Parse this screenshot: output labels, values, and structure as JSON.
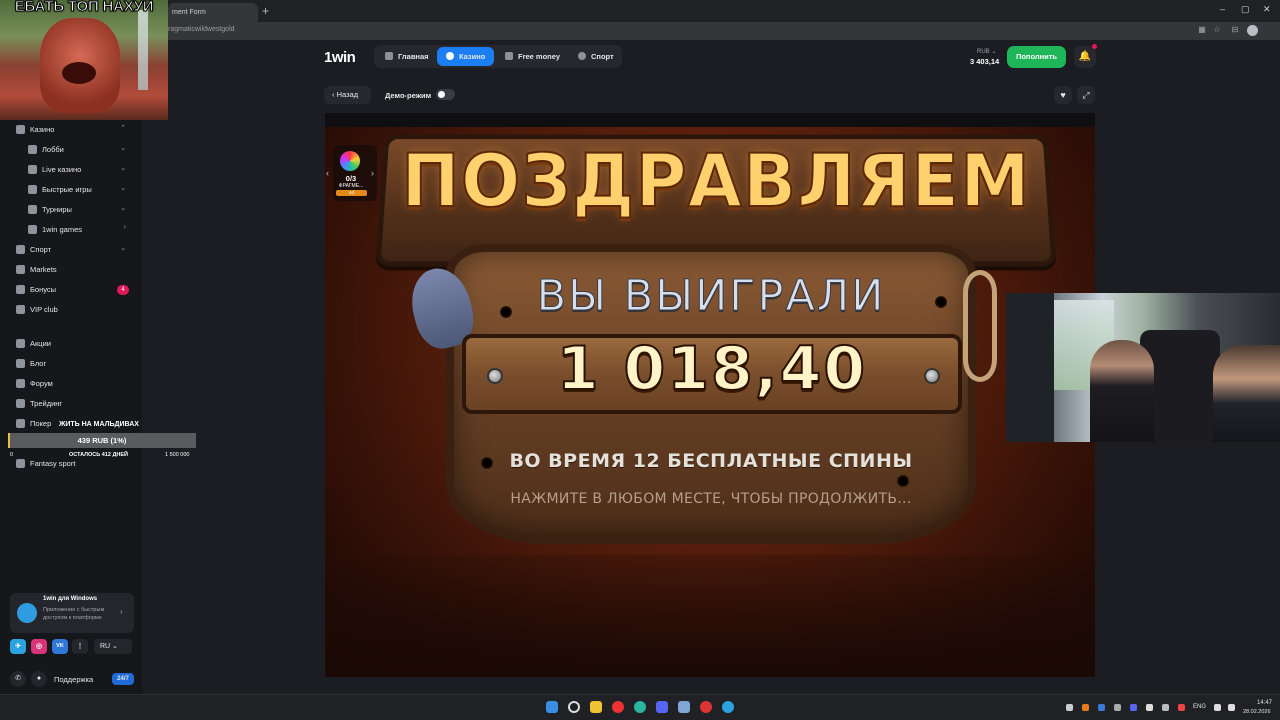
{
  "browser": {
    "tab_title": "ment Form",
    "url": "ragmaticwildwestgold",
    "new_tab": "+",
    "win_min": "–",
    "win_max": "▢",
    "win_close": "✕"
  },
  "overlay": {
    "meme_caption": "ЕБАТЬ ТОП НАХУЙ"
  },
  "header": {
    "logo": "1win",
    "nav": [
      {
        "label": "Главная",
        "icon": "home-icon"
      },
      {
        "label": "Казино",
        "icon": "casino-chip-icon"
      },
      {
        "label": "Free money",
        "icon": "wallet-icon"
      },
      {
        "label": "Спорт",
        "icon": "sport-ball-icon"
      }
    ],
    "currency": "RUB ⌄",
    "balance": "3 403,14",
    "deposit_label": "Пополнить",
    "bell_icon": "bell-icon"
  },
  "subheader": {
    "back_label": "‹   Назад",
    "demo_label": "Демо-режим",
    "demo_on": false
  },
  "sidebar": {
    "items": [
      {
        "label": "Казино",
        "chev": "⌃"
      },
      {
        "label": "Лобби",
        "chev": "⌄"
      },
      {
        "label": "Live казино",
        "chev": "⌄"
      },
      {
        "label": "Быстрые игры",
        "chev": "⌄"
      },
      {
        "label": "Турниры",
        "chev": "⌄"
      },
      {
        "label": "1win games",
        "chev": "›"
      },
      {
        "label": "Спорт",
        "chev": "⌄"
      },
      {
        "label": "Markets",
        "chev": ""
      },
      {
        "label": "Бонусы",
        "chev": ""
      },
      {
        "label": "VIP club",
        "chev": ""
      },
      {
        "label": "Акции",
        "chev": ""
      },
      {
        "label": "Блог",
        "chev": ""
      },
      {
        "label": "Форум",
        "chev": ""
      },
      {
        "label": "Трейдинг",
        "chev": ""
      },
      {
        "label": "Покер",
        "chev": ""
      },
      {
        "label": "Fantasy sport",
        "chev": ""
      }
    ],
    "bonus_badge": "4",
    "app": {
      "title": "1win для Windows",
      "desc": "Приложение с быстрым доступом к платформе"
    },
    "socials": [
      "✈",
      "◎",
      "VK",
      "⋮"
    ],
    "lang": "RU ⌄",
    "support_label": "Поддержка",
    "support_badge": "24/7"
  },
  "donation_goal": {
    "title": "ЖИТЬ НА МАЛЬДИВАХ",
    "amount": "439 RUB (1%)",
    "progress": 0.01,
    "start": "0",
    "remaining": "ОСТАЛОСЬ 412 ДНЕЙ",
    "target": "1 500 000"
  },
  "game": {
    "title": "ПОЗДРАВЛЯЕМ",
    "won_label": "ВЫ ВЫИГРАЛИ",
    "amount": "1 018,40",
    "spins_text": "ВО ВРЕМЯ 12 БЕСПЛАТНЫЕ СПИНЫ",
    "continue_text": "НАЖМИТЕ В ЛЮБОМ МЕСТЕ, ЧТОБЫ ПРОДОЛЖИТЬ...",
    "fragments_count": "0/3",
    "fragments_label": "ФРАГМЕ...",
    "fragments_badge": "4d"
  },
  "taskbar": {
    "lang": "ENG",
    "time": "14:47",
    "date": "28.02.2026"
  },
  "colors": {
    "accent_blue": "#1b7ef2",
    "deposit_green": "#1fb65a",
    "badge_pink": "#e3185b",
    "title_gold": "#ffd06e"
  }
}
